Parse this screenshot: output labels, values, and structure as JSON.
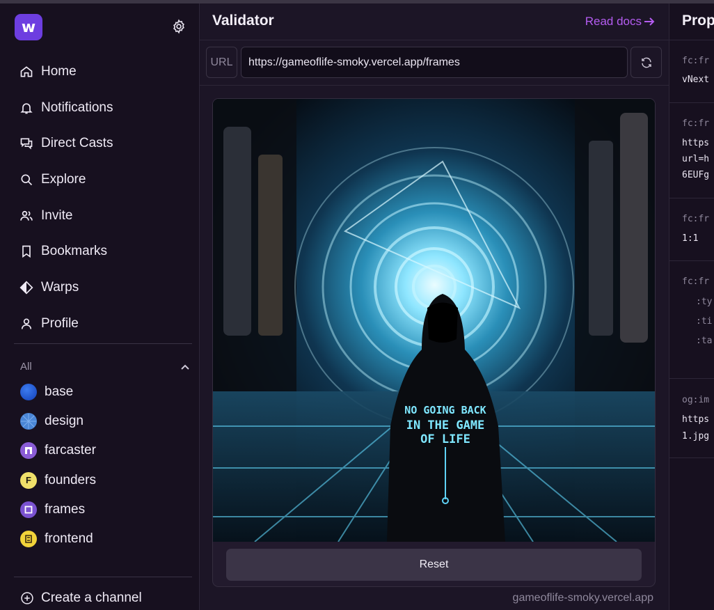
{
  "app": {
    "logo_letter": "w",
    "accent": "#6d3ee0"
  },
  "sidebar": {
    "nav": [
      {
        "label": "Home",
        "icon": "home-icon"
      },
      {
        "label": "Notifications",
        "icon": "bell-icon"
      },
      {
        "label": "Direct Casts",
        "icon": "chat-icon"
      },
      {
        "label": "Explore",
        "icon": "search-icon"
      },
      {
        "label": "Invite",
        "icon": "users-icon"
      },
      {
        "label": "Bookmarks",
        "icon": "bookmark-icon"
      },
      {
        "label": "Warps",
        "icon": "warps-icon"
      },
      {
        "label": "Profile",
        "icon": "user-icon"
      }
    ],
    "section_label": "All",
    "channels": [
      {
        "label": "base",
        "icon": "base-channel-icon",
        "color": "#1f5fe0"
      },
      {
        "label": "design",
        "icon": "design-channel-icon",
        "color": "#4a86d6"
      },
      {
        "label": "farcaster",
        "icon": "farcaster-channel-icon",
        "color": "#8a5cd6"
      },
      {
        "label": "founders",
        "icon": "founders-channel-icon",
        "color": "#f0e06a",
        "glyph": "F"
      },
      {
        "label": "frames",
        "icon": "frames-channel-icon",
        "color": "#7a52d0"
      },
      {
        "label": "frontend",
        "icon": "frontend-channel-icon",
        "color": "#f2d33a"
      }
    ],
    "create_channel": "Create a channel"
  },
  "main": {
    "title": "Validator",
    "read_docs": "Read docs",
    "url_label": "URL",
    "url_value": "https://gameoflife-smoky.vercel.app/frames",
    "frame_text_lines": [
      "NO GOING BACK",
      "IN THE GAME",
      "OF LIFE"
    ],
    "reset_label": "Reset",
    "frame_domain": "gameoflife-smoky.vercel.app"
  },
  "properties": {
    "title": "Prop",
    "items": [
      {
        "key": "fc:fr",
        "values": [
          "vNext"
        ]
      },
      {
        "key": "fc:fr",
        "values": [
          "https",
          "url=h",
          "6EUFg"
        ]
      },
      {
        "key": "fc:fr",
        "values": [
          "1:1"
        ]
      },
      {
        "key": "fc:fr",
        "values": [
          ":ty",
          ":ti",
          ":ta"
        ]
      },
      {
        "key": "og:im",
        "values": [
          "https",
          "1.jpg"
        ]
      }
    ]
  }
}
